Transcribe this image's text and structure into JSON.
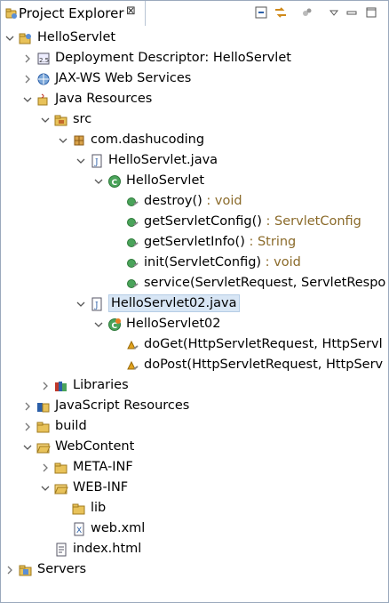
{
  "view": {
    "tab_title": "Project Explorer",
    "close_glyph": "⊠",
    "toolbar_icons": [
      "collapse-all-icon",
      "link-with-editor-icon",
      "filter-icon",
      "view-menu-icon",
      "minimize-icon",
      "maximize-icon"
    ]
  },
  "tree": [
    {
      "name": "hello-servlet-project",
      "text": "HelloServlet",
      "suffix": "",
      "depth": 0,
      "expand": "open",
      "icon": "project-icon",
      "selected": false
    },
    {
      "name": "deployment-descriptor",
      "text": "Deployment Descriptor: HelloServlet",
      "suffix": "",
      "depth": 1,
      "expand": "closed",
      "icon": "deployment-descriptor-icon",
      "selected": false
    },
    {
      "name": "jax-ws-web-services",
      "text": "JAX-WS Web Services",
      "suffix": "",
      "depth": 1,
      "expand": "closed",
      "icon": "web-services-icon",
      "selected": false
    },
    {
      "name": "java-resources",
      "text": "Java Resources",
      "suffix": "",
      "depth": 1,
      "expand": "open",
      "icon": "java-resources-icon",
      "selected": false
    },
    {
      "name": "src-folder",
      "text": "src",
      "suffix": "",
      "depth": 2,
      "expand": "open",
      "icon": "source-folder-icon",
      "selected": false
    },
    {
      "name": "package-com-dashucoding",
      "text": "com.dashucoding",
      "suffix": "",
      "depth": 3,
      "expand": "open",
      "icon": "package-icon",
      "selected": false
    },
    {
      "name": "file-helloservlet-java",
      "text": "HelloServlet.java",
      "suffix": "",
      "depth": 4,
      "expand": "open",
      "icon": "java-file-icon",
      "selected": false
    },
    {
      "name": "class-helloservlet",
      "text": "HelloServlet",
      "suffix": "",
      "depth": 5,
      "expand": "open",
      "icon": "class-icon",
      "selected": false
    },
    {
      "name": "method-destroy",
      "text": "destroy()",
      "suffix": " : void",
      "depth": 6,
      "expand": "none",
      "icon": "public-method-icon",
      "selected": false
    },
    {
      "name": "method-getservletconfig",
      "text": "getServletConfig()",
      "suffix": " : ServletConfig",
      "depth": 6,
      "expand": "none",
      "icon": "public-method-icon",
      "selected": false
    },
    {
      "name": "method-getservletinfo",
      "text": "getServletInfo()",
      "suffix": " : String",
      "depth": 6,
      "expand": "none",
      "icon": "public-method-icon",
      "selected": false
    },
    {
      "name": "method-init",
      "text": "init(ServletConfig)",
      "suffix": " : void",
      "depth": 6,
      "expand": "none",
      "icon": "public-method-icon",
      "selected": false
    },
    {
      "name": "method-service",
      "text": "service(ServletRequest, ServletRespo",
      "suffix": "",
      "depth": 6,
      "expand": "none",
      "icon": "public-method-icon",
      "selected": false
    },
    {
      "name": "file-helloservlet02-java",
      "text": "HelloServlet02.java",
      "suffix": "",
      "depth": 4,
      "expand": "open",
      "icon": "java-file-icon",
      "selected": true
    },
    {
      "name": "class-helloservlet02",
      "text": "HelloServlet02",
      "suffix": "",
      "depth": 5,
      "expand": "open",
      "icon": "servlet-class-icon",
      "selected": false
    },
    {
      "name": "method-doget",
      "text": "doGet(HttpServletRequest, HttpServl",
      "suffix": "",
      "depth": 6,
      "expand": "none",
      "icon": "protected-method-icon",
      "selected": false
    },
    {
      "name": "method-dopost",
      "text": "doPost(HttpServletRequest, HttpServ",
      "suffix": "",
      "depth": 6,
      "expand": "none",
      "icon": "protected-method-icon",
      "selected": false
    },
    {
      "name": "libraries",
      "text": "Libraries",
      "suffix": "",
      "depth": 2,
      "expand": "closed",
      "icon": "libraries-icon",
      "selected": false
    },
    {
      "name": "javascript-resources",
      "text": "JavaScript Resources",
      "suffix": "",
      "depth": 1,
      "expand": "closed",
      "icon": "javascript-resources-icon",
      "selected": false
    },
    {
      "name": "build-folder",
      "text": "build",
      "suffix": "",
      "depth": 1,
      "expand": "closed",
      "icon": "folder-icon",
      "selected": false
    },
    {
      "name": "webcontent-folder",
      "text": "WebContent",
      "suffix": "",
      "depth": 1,
      "expand": "open",
      "icon": "folder-open-icon",
      "selected": false
    },
    {
      "name": "meta-inf-folder",
      "text": "META-INF",
      "suffix": "",
      "depth": 2,
      "expand": "closed",
      "icon": "folder-icon",
      "selected": false
    },
    {
      "name": "web-inf-folder",
      "text": "WEB-INF",
      "suffix": "",
      "depth": 2,
      "expand": "open",
      "icon": "folder-open-icon",
      "selected": false
    },
    {
      "name": "lib-folder",
      "text": "lib",
      "suffix": "",
      "depth": 3,
      "expand": "none",
      "icon": "folder-icon",
      "selected": false
    },
    {
      "name": "web-xml-file",
      "text": "web.xml",
      "suffix": "",
      "depth": 3,
      "expand": "none",
      "icon": "xml-file-icon",
      "selected": false
    },
    {
      "name": "index-html-file",
      "text": "index.html",
      "suffix": "",
      "depth": 2,
      "expand": "none",
      "icon": "html-file-icon",
      "selected": false
    },
    {
      "name": "servers-project",
      "text": "Servers",
      "suffix": "",
      "depth": 0,
      "expand": "closed",
      "icon": "servers-folder-icon",
      "selected": false
    }
  ],
  "colors": {
    "selection": "#d8e6f5",
    "decoration": "#8b6b2b",
    "border": "#9aa9bd"
  }
}
